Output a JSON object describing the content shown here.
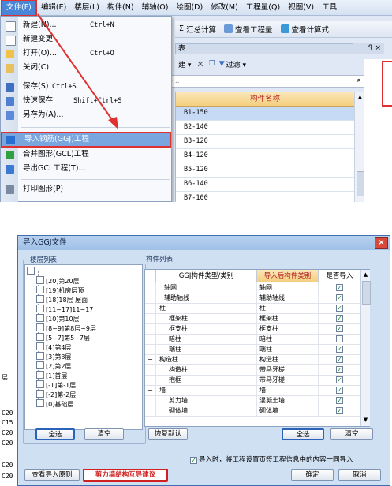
{
  "menubar": {
    "items": [
      "文件(F)",
      "编辑(E)",
      "楼层(L)",
      "构件(N)",
      "辅轴(O)",
      "绘图(D)",
      "修改(M)",
      "工程量(Q)",
      "视图(V)",
      "工具"
    ]
  },
  "toolbar": {
    "items": [
      "汇总计算",
      "查看工程量",
      "查看计算式"
    ]
  },
  "panel": {
    "title": "表",
    "pin": "ꟼ ×",
    "new_label": "建 ▾",
    "filter_label": "过滤 ▾",
    "search_placeholder": "件...",
    "column_header": "构件名称",
    "rows": [
      "B1-150",
      "B2-140",
      "B3-120",
      "B4-120",
      "B5-120",
      "B6-140",
      "B7-100"
    ]
  },
  "file_menu": {
    "items": [
      {
        "label": "新建(N)...",
        "shortcut": "Ctrl+N"
      },
      {
        "label": "新建变更",
        "shortcut": ""
      },
      {
        "label": "打开(O)...",
        "shortcut": "Ctrl+O"
      },
      {
        "label": "关闭(C)",
        "shortcut": ""
      },
      {
        "label": "保存(S)",
        "shortcut": "Ctrl+S"
      },
      {
        "label": "快速保存",
        "shortcut": "Shift+Ctrl+S"
      },
      {
        "label": "另存为(A)...",
        "shortcut": ""
      },
      {
        "label": "导入钢筋(GGJ)工程",
        "shortcut": ""
      },
      {
        "label": "合并图形(GCL)工程",
        "shortcut": ""
      },
      {
        "label": "导出GCL工程(T)...",
        "shortcut": ""
      },
      {
        "label": "打印图形(P)",
        "shortcut": ""
      }
    ]
  },
  "dialog": {
    "title": "导入GGJ文件",
    "close": "×",
    "floor_group": "楼层列表",
    "component_group": "构件列表",
    "floors": [
      "[20]第20层",
      "[19]机房层顶",
      "[18]18层 屋面",
      "[11~17]11~17",
      "[10]第10层",
      "[8~9]第8层~9层",
      "[5~7]第5~7层",
      "[4]第4层",
      "[3]第3层",
      "[2]第2层",
      "[1]首层",
      "[-1]第-1层",
      "[-2]第-2层",
      "[0]基础层"
    ],
    "table_headers": [
      "GGJ构件类型/类别",
      "导入后构件类别",
      "是否导入"
    ],
    "table_rows": [
      {
        "src": "轴网",
        "dst": "轴网",
        "checked": true,
        "indent": 1,
        "expander": ""
      },
      {
        "src": "辅助轴线",
        "dst": "辅助轴线",
        "checked": true,
        "indent": 1,
        "expander": ""
      },
      {
        "src": "柱",
        "dst": "柱",
        "checked": true,
        "indent": 0,
        "expander": "−"
      },
      {
        "src": "框架柱",
        "dst": "框架柱",
        "checked": true,
        "indent": 2,
        "expander": ""
      },
      {
        "src": "框支柱",
        "dst": "框支柱",
        "checked": true,
        "indent": 2,
        "expander": ""
      },
      {
        "src": "暗柱",
        "dst": "暗柱",
        "checked": false,
        "indent": 2,
        "expander": ""
      },
      {
        "src": "端柱",
        "dst": "端柱",
        "checked": true,
        "indent": 2,
        "expander": ""
      },
      {
        "src": "构造柱",
        "dst": "构造柱",
        "checked": true,
        "indent": 0,
        "expander": "−"
      },
      {
        "src": "构造柱",
        "dst": "带马牙槎",
        "checked": true,
        "indent": 2,
        "expander": ""
      },
      {
        "src": "抱框",
        "dst": "带马牙槎",
        "checked": true,
        "indent": 2,
        "expander": ""
      },
      {
        "src": "墙",
        "dst": "墙",
        "checked": true,
        "indent": 0,
        "expander": "−"
      },
      {
        "src": "剪力墙",
        "dst": "混凝土墙",
        "checked": true,
        "indent": 2,
        "expander": ""
      },
      {
        "src": "砌体墙",
        "dst": "砌体墙",
        "checked": true,
        "indent": 2,
        "expander": ""
      }
    ],
    "btn_select_all_left": "全选",
    "btn_clear_left": "清空",
    "btn_restore_default": "恢复默认",
    "btn_select_all_right": "全选",
    "btn_clear_right": "清空",
    "checkbox_text": "导入时，将工程设置页签工程信息中的内容一同导入",
    "checkbox_checked": true,
    "btn_view_rules": "查看导入原则",
    "btn_red": "剪力墙结构互导建议",
    "btn_ok": "确定",
    "btn_cancel": "取消"
  },
  "background_left_labels": [
    "层",
    "C20",
    "C15",
    "C20",
    "C20",
    "C20",
    "C20"
  ],
  "colors": {
    "highlight_red": "#e03030",
    "menu_blue": "#4a86d8",
    "header_orange": "#f4cf7e"
  }
}
